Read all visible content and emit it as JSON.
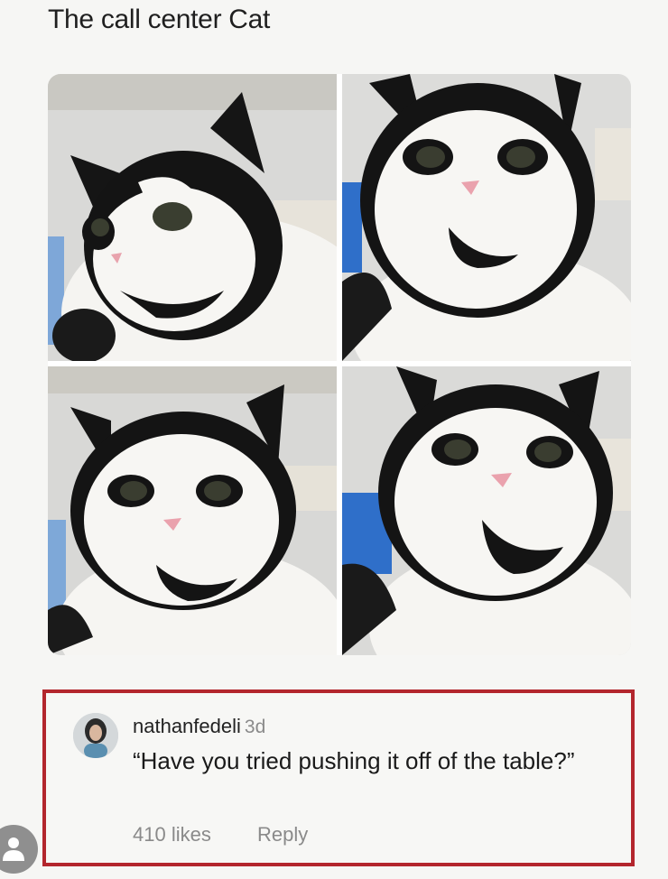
{
  "post": {
    "title": "The call center Cat"
  },
  "photos": [
    {
      "name": "cat-photo-top-left",
      "icon": "cat-photo"
    },
    {
      "name": "cat-photo-top-right",
      "icon": "cat-photo"
    },
    {
      "name": "cat-photo-bottom-left",
      "icon": "cat-photo"
    },
    {
      "name": "cat-photo-bottom-right",
      "icon": "cat-photo"
    }
  ],
  "comment": {
    "username": "nathanfedeli",
    "time": "3d",
    "text": "“Have you tried pushing it off of the table?”",
    "likes": "410 likes",
    "reply_label": "Reply",
    "avatar_icon": "user-avatar",
    "highlight_color": "#b3262d"
  },
  "profile_button": {
    "icon": "person-icon"
  }
}
